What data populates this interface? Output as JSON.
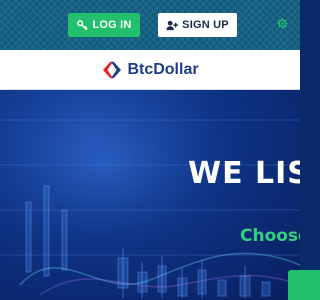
{
  "header": {
    "login_label": "LOG IN",
    "signup_label": "SIGN UP",
    "login_icon": "key-icon",
    "signup_icon": "user-plus-icon",
    "settings_icon": "gear-icon"
  },
  "brand": {
    "name": "BtcDollar",
    "logo_icon": "carrefour-style-logo",
    "color": "#1d3f86"
  },
  "hero": {
    "title": "WE LIST",
    "subtitle": "Choose"
  },
  "colors": {
    "accent_green": "#22c06c",
    "topbar": "#0f5b7e",
    "hero_blue": "#0d3386"
  }
}
